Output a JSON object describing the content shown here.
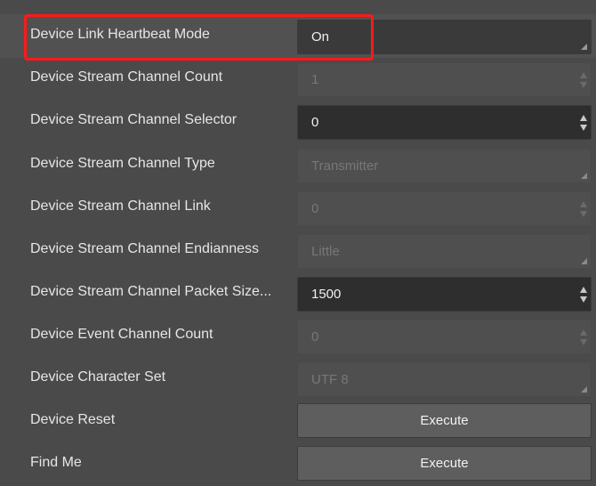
{
  "rows": [
    {
      "label": "Device Link Heartbeat Mode",
      "value": "On"
    },
    {
      "label": "Device Stream Channel Count",
      "value": "1"
    },
    {
      "label": "Device Stream Channel Selector",
      "value": "0"
    },
    {
      "label": "Device Stream Channel Type",
      "value": "Transmitter"
    },
    {
      "label": "Device Stream Channel Link",
      "value": "0"
    },
    {
      "label": "Device Stream Channel Endianness",
      "value": "Little"
    },
    {
      "label": "Device Stream Channel Packet Size...",
      "value": "1500"
    },
    {
      "label": "Device Event Channel Count",
      "value": "0"
    },
    {
      "label": "Device Character Set",
      "value": "UTF 8"
    },
    {
      "label": "Device Reset",
      "button": "Execute"
    },
    {
      "label": "Find Me",
      "button": "Execute"
    }
  ],
  "icons": {
    "spin": "spinbox-arrows-icon",
    "dropdown": "dropdown-corner-icon"
  },
  "colors": {
    "highlight": "#ff1a1a",
    "editable_bg": "#2e2e2e",
    "readonly_bg": "#4f4f4f",
    "panel_bg": "#4a4a4a"
  }
}
